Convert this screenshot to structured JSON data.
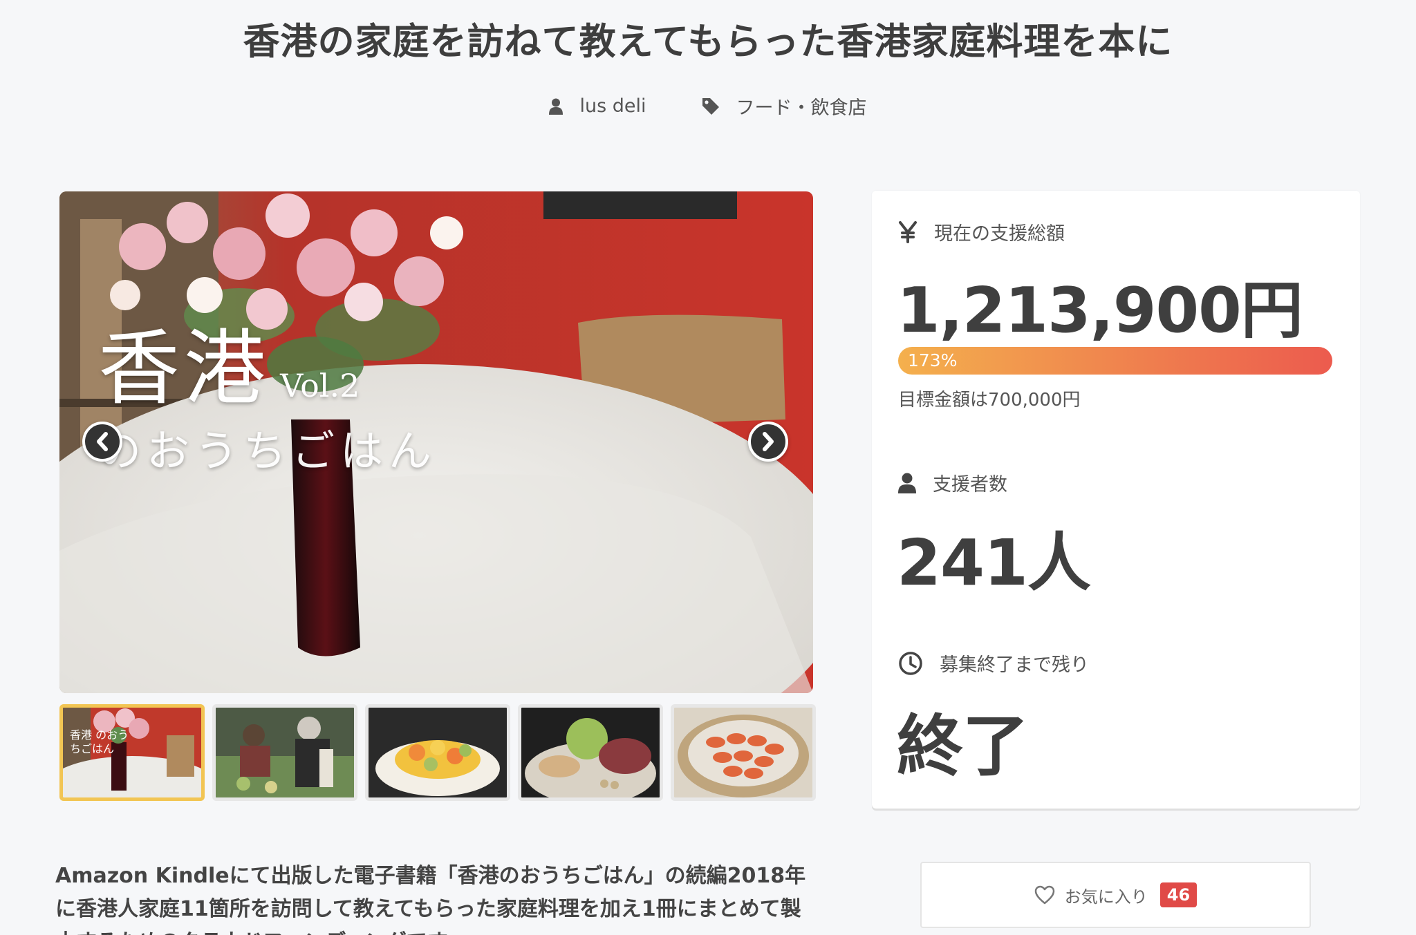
{
  "page_title": "香港の家庭を訪ねて教えてもらった香港家庭料理を本に",
  "meta": {
    "author": "lus deli",
    "category": "フード・飲食店",
    "author_icon": "user-icon",
    "category_icon": "tag-icon"
  },
  "hero": {
    "title_main": "香港",
    "title_vol": "Vol.2",
    "title_sub": "のおうちごはん",
    "prev_icon": "chevron-left-icon",
    "next_icon": "chevron-right-icon"
  },
  "thumbnails": [
    {
      "label": "香港 のおうちごはん",
      "active": true
    },
    {
      "label": "",
      "active": false
    },
    {
      "label": "",
      "active": false
    },
    {
      "label": "",
      "active": false
    },
    {
      "label": "",
      "active": false
    }
  ],
  "stats": {
    "total_label": "現在の支援総額",
    "total_icon": "yen-icon",
    "total_value": "1,213,900円",
    "progress_text": "173%",
    "progress_fraction": 1.0,
    "goal_text": "目標金額は700,000円",
    "backers_label": "支援者数",
    "backers_icon": "user-icon",
    "backers_value": "241人",
    "remaining_label": "募集終了まで残り",
    "remaining_icon": "clock-icon",
    "remaining_value": "終了"
  },
  "description": "Amazon Kindleにて出版した電子書籍「香港のおうちごはん」の続編2018年に香港人家庭11箇所を訪問して教えてもらった家庭料理を加え1冊にまとめて製本するためのクラウドファンディングです。",
  "favorite": {
    "label": "お気に入り",
    "count": "46",
    "icon": "heart-icon"
  },
  "colors": {
    "accent": "#e04a47",
    "progress_start": "#f4b04d",
    "progress_end": "#ec5b4e",
    "thumb_active": "#f2c553"
  }
}
